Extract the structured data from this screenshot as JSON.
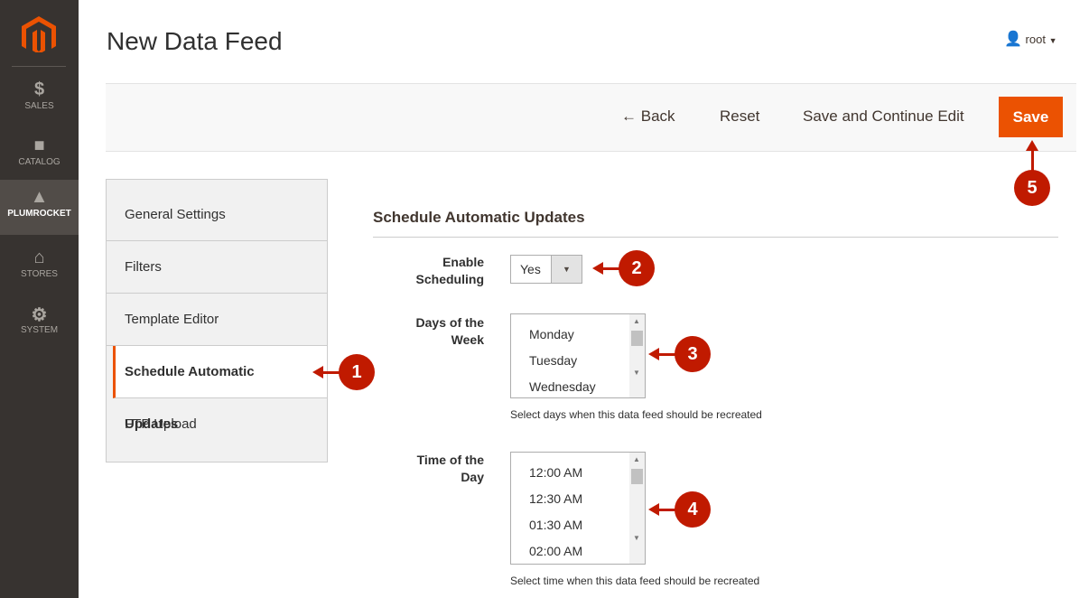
{
  "sidebar": {
    "items": [
      {
        "label": "SALES",
        "icon": "dollar-icon"
      },
      {
        "label": "CATALOG",
        "icon": "box-icon"
      },
      {
        "label": "PLUMROCKET",
        "icon": "plumrocket-icon",
        "active": true
      },
      {
        "label": "STORES",
        "icon": "store-icon"
      },
      {
        "label": "SYSTEM",
        "icon": "gear-icon"
      }
    ]
  },
  "header": {
    "title": "New Data Feed",
    "user": "root"
  },
  "toolbar": {
    "back": "Back",
    "reset": "Reset",
    "save_continue": "Save and Continue Edit",
    "save": "Save"
  },
  "tabs": [
    "General Settings",
    "Filters",
    "Template Editor",
    "Schedule Automatic Updates",
    "FTP Upload"
  ],
  "section": {
    "title": "Schedule Automatic Updates",
    "enable_label": "Enable Scheduling",
    "enable_value": "Yes",
    "days_label": "Days of the Week",
    "days": [
      "Monday",
      "Tuesday",
      "Wednesday"
    ],
    "days_note": "Select days when this data feed should be recreated",
    "time_label": "Time of the Day",
    "times": [
      "12:00 AM",
      "12:30 AM",
      "01:30 AM",
      "02:00 AM"
    ],
    "time_note": "Select time when this data feed should be recreated"
  },
  "annotations": [
    "1",
    "2",
    "3",
    "4",
    "5"
  ],
  "colors": {
    "accent": "#eb5202",
    "annotation": "#c01a00",
    "sidebar": "#373330"
  }
}
